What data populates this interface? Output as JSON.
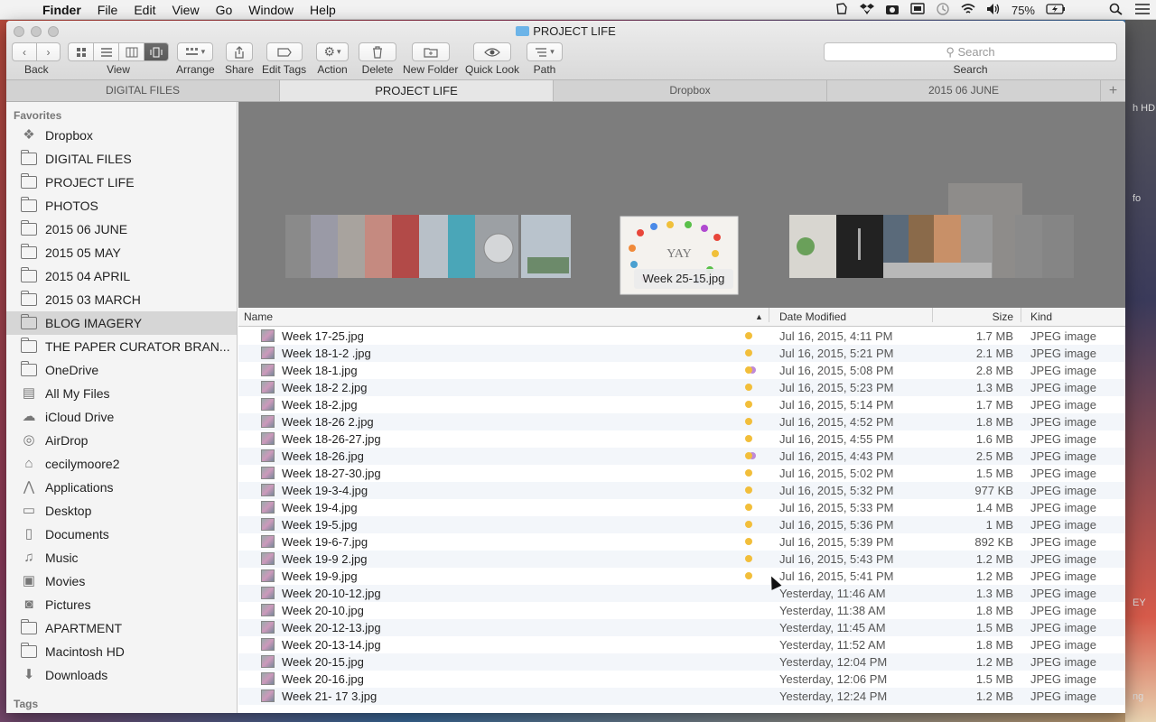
{
  "menubar": {
    "app": "Finder",
    "items": [
      "File",
      "Edit",
      "View",
      "Go",
      "Window",
      "Help"
    ],
    "battery": "75%"
  },
  "window": {
    "title": "PROJECT LIFE"
  },
  "toolbar": {
    "back": "Back",
    "view": "View",
    "arrange": "Arrange",
    "share": "Share",
    "edit_tags": "Edit Tags",
    "action": "Action",
    "delete": "Delete",
    "new_folder": "New Folder",
    "quick_look": "Quick Look",
    "path": "Path",
    "search_placeholder": "Search",
    "search_label": "Search"
  },
  "tabs": [
    "DIGITAL FILES",
    "PROJECT LIFE",
    "Dropbox",
    "2015 06 JUNE"
  ],
  "sidebar": {
    "favorites_header": "Favorites",
    "tags_header": "Tags",
    "items": [
      {
        "label": "Dropbox",
        "icon": "dropbox-icon"
      },
      {
        "label": "DIGITAL FILES",
        "icon": "folder-icon"
      },
      {
        "label": "PROJECT LIFE",
        "icon": "folder-icon"
      },
      {
        "label": "PHOTOS",
        "icon": "folder-icon"
      },
      {
        "label": "2015 06 JUNE",
        "icon": "folder-icon"
      },
      {
        "label": "2015 05 MAY",
        "icon": "folder-icon"
      },
      {
        "label": "2015 04 APRIL",
        "icon": "folder-icon"
      },
      {
        "label": "2015 03 MARCH",
        "icon": "folder-icon"
      },
      {
        "label": "BLOG IMAGERY",
        "icon": "folder-icon"
      },
      {
        "label": "THE PAPER CURATOR BRAN...",
        "icon": "folder-icon"
      },
      {
        "label": "OneDrive",
        "icon": "folder-icon"
      },
      {
        "label": "All My Files",
        "icon": "all-files-icon"
      },
      {
        "label": "iCloud Drive",
        "icon": "cloud-icon"
      },
      {
        "label": "AirDrop",
        "icon": "airdrop-icon"
      },
      {
        "label": "cecilymoore2",
        "icon": "home-icon"
      },
      {
        "label": "Applications",
        "icon": "applications-icon"
      },
      {
        "label": "Desktop",
        "icon": "desktop-icon"
      },
      {
        "label": "Documents",
        "icon": "documents-icon"
      },
      {
        "label": "Music",
        "icon": "music-icon"
      },
      {
        "label": "Movies",
        "icon": "movies-icon"
      },
      {
        "label": "Pictures",
        "icon": "pictures-icon"
      },
      {
        "label": "APARTMENT",
        "icon": "folder-icon"
      },
      {
        "label": "Macintosh HD",
        "icon": "folder-icon"
      },
      {
        "label": "Downloads",
        "icon": "downloads-icon"
      }
    ]
  },
  "coverflow": {
    "caption": "Week 25-15.jpg",
    "center_text": "YAY"
  },
  "columns": {
    "name": "Name",
    "date": "Date Modified",
    "size": "Size",
    "kind": "Kind"
  },
  "files": [
    {
      "name": "Week 17-25.jpg",
      "tag": "yellow",
      "date": "Jul 16, 2015, 4:11 PM",
      "size": "1.7 MB",
      "kind": "JPEG image"
    },
    {
      "name": "Week 18-1-2 .jpg",
      "tag": "yellow",
      "date": "Jul 16, 2015, 5:21 PM",
      "size": "2.1 MB",
      "kind": "JPEG image"
    },
    {
      "name": "Week 18-1.jpg",
      "tag": "yellow-purple",
      "date": "Jul 16, 2015, 5:08 PM",
      "size": "2.8 MB",
      "kind": "JPEG image"
    },
    {
      "name": "Week 18-2 2.jpg",
      "tag": "yellow",
      "date": "Jul 16, 2015, 5:23 PM",
      "size": "1.3 MB",
      "kind": "JPEG image"
    },
    {
      "name": "Week 18-2.jpg",
      "tag": "yellow",
      "date": "Jul 16, 2015, 5:14 PM",
      "size": "1.7 MB",
      "kind": "JPEG image"
    },
    {
      "name": "Week 18-26 2.jpg",
      "tag": "yellow",
      "date": "Jul 16, 2015, 4:52 PM",
      "size": "1.8 MB",
      "kind": "JPEG image"
    },
    {
      "name": "Week 18-26-27.jpg",
      "tag": "yellow",
      "date": "Jul 16, 2015, 4:55 PM",
      "size": "1.6 MB",
      "kind": "JPEG image"
    },
    {
      "name": "Week 18-26.jpg",
      "tag": "yellow-purple",
      "date": "Jul 16, 2015, 4:43 PM",
      "size": "2.5 MB",
      "kind": "JPEG image"
    },
    {
      "name": "Week 18-27-30.jpg",
      "tag": "yellow",
      "date": "Jul 16, 2015, 5:02 PM",
      "size": "1.5 MB",
      "kind": "JPEG image"
    },
    {
      "name": "Week 19-3-4.jpg",
      "tag": "yellow",
      "date": "Jul 16, 2015, 5:32 PM",
      "size": "977 KB",
      "kind": "JPEG image"
    },
    {
      "name": "Week 19-4.jpg",
      "tag": "yellow",
      "date": "Jul 16, 2015, 5:33 PM",
      "size": "1.4 MB",
      "kind": "JPEG image"
    },
    {
      "name": "Week 19-5.jpg",
      "tag": "yellow",
      "date": "Jul 16, 2015, 5:36 PM",
      "size": "1 MB",
      "kind": "JPEG image"
    },
    {
      "name": "Week 19-6-7.jpg",
      "tag": "yellow",
      "date": "Jul 16, 2015, 5:39 PM",
      "size": "892 KB",
      "kind": "JPEG image"
    },
    {
      "name": "Week 19-9 2.jpg",
      "tag": "yellow",
      "date": "Jul 16, 2015, 5:43 PM",
      "size": "1.2 MB",
      "kind": "JPEG image"
    },
    {
      "name": "Week 19-9.jpg",
      "tag": "yellow",
      "date": "Jul 16, 2015, 5:41 PM",
      "size": "1.2 MB",
      "kind": "JPEG image"
    },
    {
      "name": "Week 20-10-12.jpg",
      "tag": "",
      "date": "Yesterday, 11:46 AM",
      "size": "1.3 MB",
      "kind": "JPEG image"
    },
    {
      "name": "Week 20-10.jpg",
      "tag": "",
      "date": "Yesterday, 11:38 AM",
      "size": "1.8 MB",
      "kind": "JPEG image"
    },
    {
      "name": "Week 20-12-13.jpg",
      "tag": "",
      "date": "Yesterday, 11:45 AM",
      "size": "1.5 MB",
      "kind": "JPEG image"
    },
    {
      "name": "Week 20-13-14.jpg",
      "tag": "",
      "date": "Yesterday, 11:52 AM",
      "size": "1.8 MB",
      "kind": "JPEG image"
    },
    {
      "name": "Week 20-15.jpg",
      "tag": "",
      "date": "Yesterday, 12:04 PM",
      "size": "1.2 MB",
      "kind": "JPEG image"
    },
    {
      "name": "Week 20-16.jpg",
      "tag": "",
      "date": "Yesterday, 12:06 PM",
      "size": "1.5 MB",
      "kind": "JPEG image"
    },
    {
      "name": "Week 21- 17 3.jpg",
      "tag": "",
      "date": "Yesterday, 12:24 PM",
      "size": "1.2 MB",
      "kind": "JPEG image"
    }
  ],
  "desktop_edge_text": [
    "h HD",
    "fo",
    "EY",
    "ng"
  ]
}
